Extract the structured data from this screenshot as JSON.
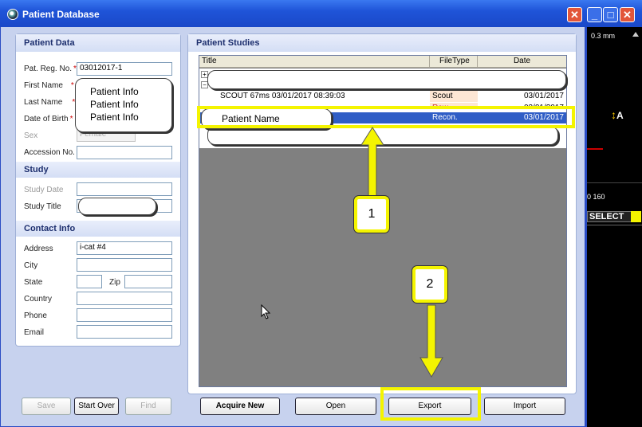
{
  "window": {
    "title": "Patient Database"
  },
  "patient_data": {
    "header": "Patient Data",
    "fields": {
      "reg_no_label": "Pat. Reg. No.",
      "reg_no_value": "03012017-1",
      "first_name_label": "First Name",
      "last_name_label": "Last Name",
      "dob_label": "Date of Birth",
      "sex_label": "Sex",
      "sex_value": "Female",
      "accession_label": "Accession No."
    },
    "callout_lines": [
      "Patient Info",
      "Patient Info",
      "Patient Info"
    ]
  },
  "study": {
    "header": "Study",
    "date_label": "Study Date",
    "title_label": "Study Title"
  },
  "contact": {
    "header": "Contact Info",
    "address_label": "Address",
    "address_value": "i-cat #4",
    "city_label": "City",
    "state_label": "State",
    "zip_label": "Zip",
    "country_label": "Country",
    "phone_label": "Phone",
    "email_label": "Email"
  },
  "left_buttons": {
    "save": "Save",
    "start_over": "Start Over",
    "find": "Find"
  },
  "studies": {
    "header": "Patient Studies",
    "columns": [
      "Title",
      "FileType",
      "Date"
    ],
    "rows": [
      {
        "title": "SCOUT 67ms 03/01/2017 08:39:03",
        "filetype": "Scout",
        "date": "03/01/2017"
      },
      {
        "title": "",
        "filetype": "Raw",
        "date": "03/01/2017"
      },
      {
        "title": "",
        "filetype": "Recon.",
        "date": "03/01/2017"
      }
    ],
    "name_callout": "Patient Name"
  },
  "bottom_buttons": {
    "acquire_new": "Acquire New",
    "open": "Open",
    "export": "Export",
    "import": "Import"
  },
  "annotations": {
    "step1": "1",
    "step2": "2"
  },
  "side_panel": {
    "scale": "0.3 mm",
    "range": "0  160",
    "select": "SELECT",
    "a_label": "A"
  }
}
